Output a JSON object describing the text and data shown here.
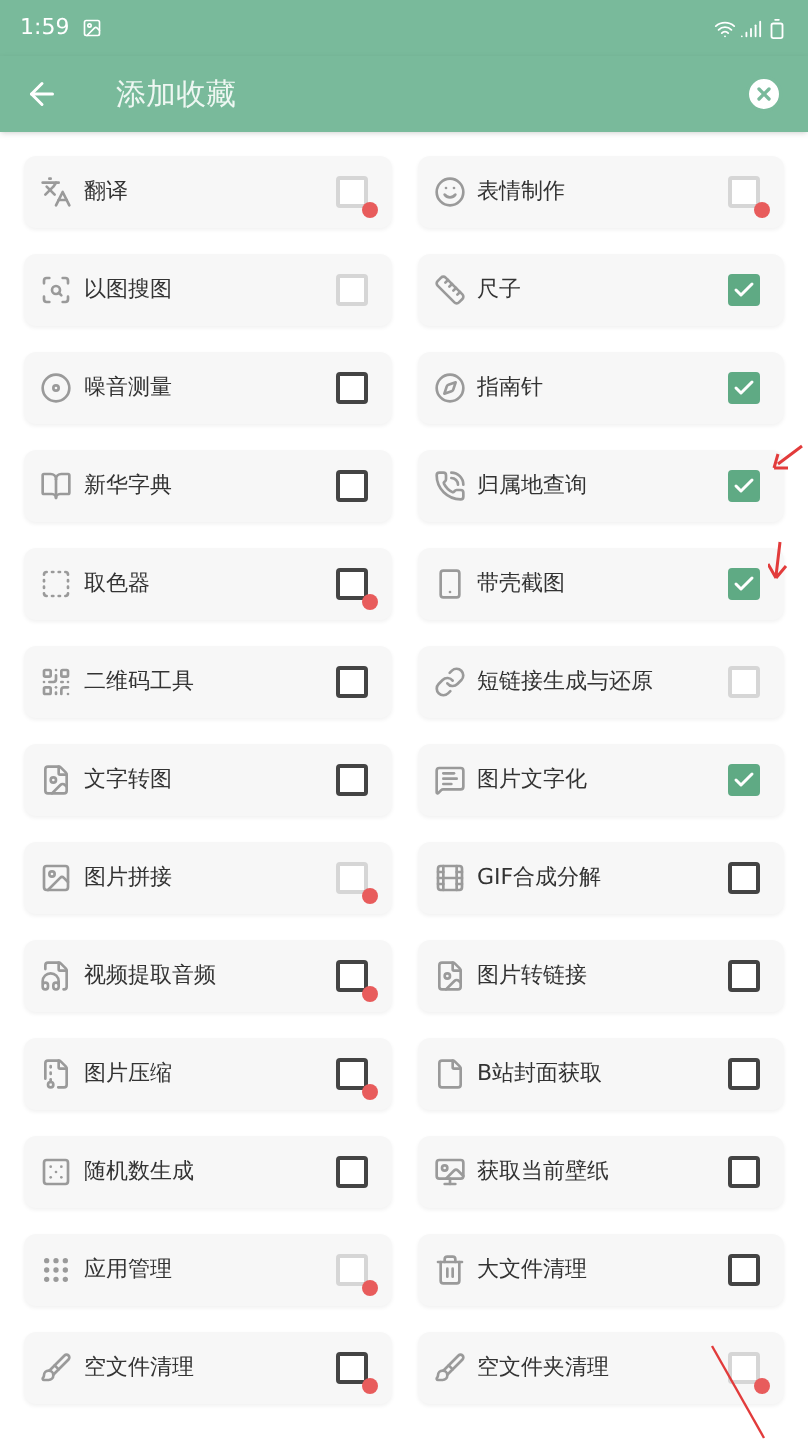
{
  "status_bar": {
    "time": "1:59"
  },
  "app_bar": {
    "title": "添加收藏"
  },
  "items": [
    {
      "label": "翻译",
      "checked": false,
      "disabled": true,
      "dot": true
    },
    {
      "label": "表情制作",
      "checked": false,
      "disabled": true,
      "dot": true
    },
    {
      "label": "以图搜图",
      "checked": false,
      "disabled": true,
      "dot": false
    },
    {
      "label": "尺子",
      "checked": true,
      "disabled": false,
      "dot": false
    },
    {
      "label": "噪音测量",
      "checked": false,
      "disabled": false,
      "dot": false
    },
    {
      "label": "指南针",
      "checked": true,
      "disabled": false,
      "dot": false
    },
    {
      "label": "新华字典",
      "checked": false,
      "disabled": false,
      "dot": false
    },
    {
      "label": "归属地查询",
      "checked": true,
      "disabled": false,
      "dot": false
    },
    {
      "label": "取色器",
      "checked": false,
      "disabled": false,
      "dot": true
    },
    {
      "label": "带壳截图",
      "checked": true,
      "disabled": false,
      "dot": false
    },
    {
      "label": "二维码工具",
      "checked": false,
      "disabled": false,
      "dot": false
    },
    {
      "label": "短链接生成与还原",
      "checked": false,
      "disabled": true,
      "dot": false
    },
    {
      "label": "文字转图",
      "checked": false,
      "disabled": false,
      "dot": false
    },
    {
      "label": "图片文字化",
      "checked": true,
      "disabled": false,
      "dot": false
    },
    {
      "label": "图片拼接",
      "checked": false,
      "disabled": true,
      "dot": true
    },
    {
      "label": "GIF合成分解",
      "checked": false,
      "disabled": false,
      "dot": false
    },
    {
      "label": "视频提取音频",
      "checked": false,
      "disabled": false,
      "dot": true
    },
    {
      "label": "图片转链接",
      "checked": false,
      "disabled": false,
      "dot": false
    },
    {
      "label": "图片压缩",
      "checked": false,
      "disabled": false,
      "dot": true
    },
    {
      "label": "B站封面获取",
      "checked": false,
      "disabled": false,
      "dot": false
    },
    {
      "label": "随机数生成",
      "checked": false,
      "disabled": false,
      "dot": false
    },
    {
      "label": "获取当前壁纸",
      "checked": false,
      "disabled": false,
      "dot": false
    },
    {
      "label": "应用管理",
      "checked": false,
      "disabled": true,
      "dot": true
    },
    {
      "label": "大文件清理",
      "checked": false,
      "disabled": false,
      "dot": false
    },
    {
      "label": "空文件清理",
      "checked": false,
      "disabled": false,
      "dot": true
    },
    {
      "label": "空文件夹清理",
      "checked": false,
      "disabled": true,
      "dot": true
    }
  ]
}
